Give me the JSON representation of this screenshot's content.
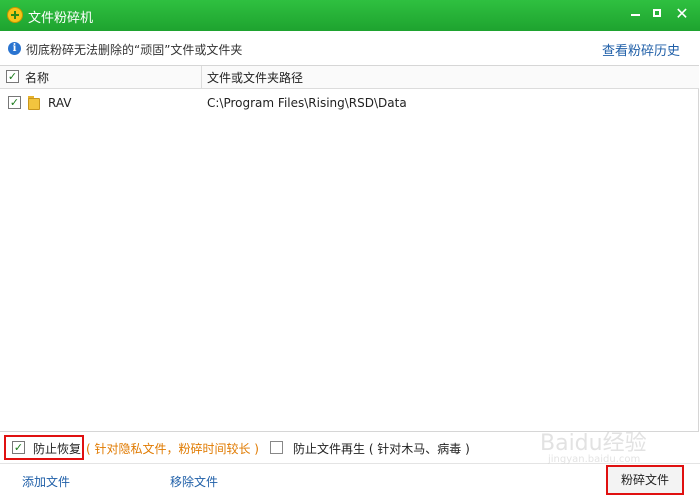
{
  "window": {
    "title": "文件粉碎机",
    "min_icon": "minimize-icon",
    "max_icon": "maximize-icon",
    "close_icon": "close-icon",
    "close_glyph": "✕"
  },
  "info": {
    "icon": "info-icon",
    "glyph": "i",
    "text": "彻底粉碎无法删除的“顽固”文件或文件夹",
    "history_link": "查看粉碎历史"
  },
  "list": {
    "columns": {
      "name": "名称",
      "path": "文件或文件夹路径"
    },
    "rows": [
      {
        "checked": true,
        "name": "RAV",
        "path": "C:\\Program Files\\Rising\\RSD\\Data"
      }
    ]
  },
  "options": {
    "prevent_recovery": {
      "checked": true,
      "label": "防止恢复",
      "note": "( 针对隐私文件，粉碎时间较长 )"
    },
    "prevent_regen": {
      "checked": false,
      "label": "防止文件再生 ( 针对木马、病毒 )"
    }
  },
  "footer": {
    "add": "添加文件",
    "remove": "移除文件",
    "shred": "粉碎文件"
  },
  "check_glyph": "✓",
  "watermark": {
    "main": "Baidu经验",
    "sub": "jingyan.baidu.com"
  },
  "colors": {
    "titlebar": "#22b032",
    "link": "#1f5fa8",
    "note": "#e07a00",
    "highlight": "#e01010"
  }
}
